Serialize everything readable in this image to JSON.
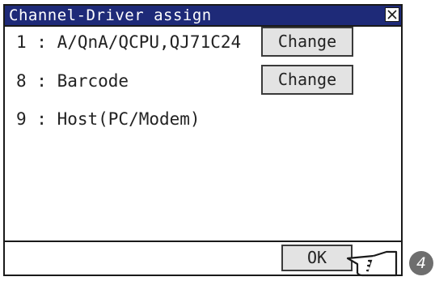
{
  "dialog": {
    "title": "Channel-Driver assign",
    "close_symbol": "×",
    "channels": [
      {
        "label": "1 : A/QnA/QCPU,QJ71C24",
        "button": "Change"
      },
      {
        "label": "8 : Barcode",
        "button": "Change"
      },
      {
        "label": "9 : Host(PC/Modem)"
      }
    ],
    "ok_label": "OK"
  },
  "annotation": {
    "step_number": "4",
    "pointer_icon": "pointing-hand-icon"
  },
  "colors": {
    "titlebar": "#1e2a78",
    "button_face": "#e3e3e3",
    "step_badge": "#6e6e6e"
  }
}
